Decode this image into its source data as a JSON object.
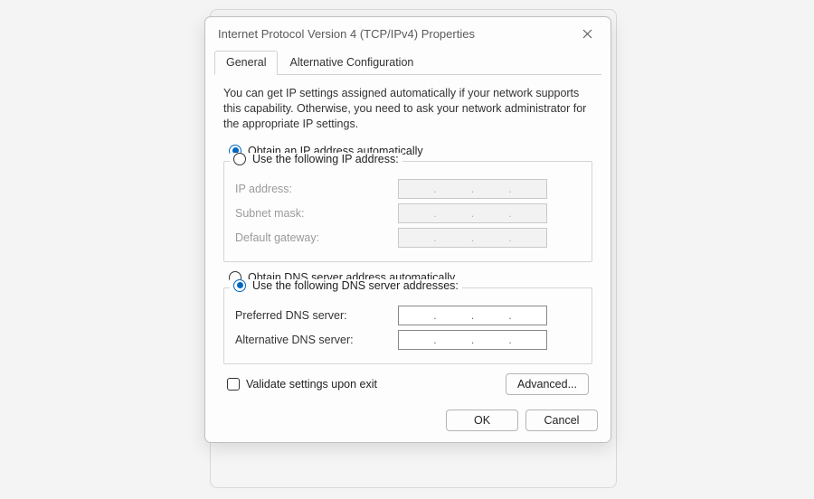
{
  "window": {
    "title": "Internet Protocol Version 4 (TCP/IPv4) Properties"
  },
  "tabs": {
    "general": "General",
    "alternative": "Alternative Configuration",
    "active": "general"
  },
  "intro_text": "You can get IP settings assigned automatically if your network supports this capability. Otherwise, you need to ask your network administrator for the appropriate IP settings.",
  "ip_section": {
    "auto_label": "Obtain an IP address automatically",
    "manual_label": "Use the following IP address:",
    "selected": "auto",
    "fields": {
      "ip_address": "IP address:",
      "subnet_mask": "Subnet mask:",
      "default_gateway": "Default gateway:"
    },
    "values": {
      "ip_address": "",
      "subnet_mask": "",
      "default_gateway": ""
    }
  },
  "dns_section": {
    "auto_label": "Obtain DNS server address automatically",
    "manual_label": "Use the following DNS server addresses:",
    "selected": "manual",
    "fields": {
      "preferred": "Preferred DNS server:",
      "alternative": "Alternative DNS server:"
    },
    "values": {
      "preferred": "",
      "alternative": ""
    }
  },
  "validate_checkbox": {
    "label": "Validate settings upon exit",
    "checked": false
  },
  "buttons": {
    "advanced": "Advanced...",
    "ok": "OK",
    "cancel": "Cancel"
  }
}
